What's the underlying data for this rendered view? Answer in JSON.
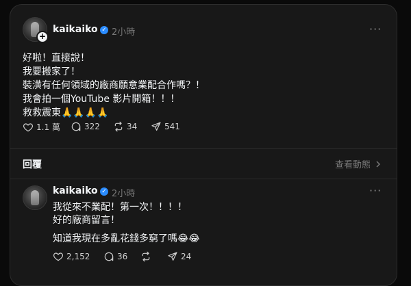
{
  "main_post": {
    "username": "kaikaiko",
    "time": "2小時",
    "more": "···",
    "lines": [
      "好啦！直接說！",
      "我要搬家了！",
      "裝潢有任何領域的廠商願意業配合作嗎？！",
      "我會拍一個YouTube 影片開箱！！！",
      "救救震東🙏🙏🙏🙏"
    ],
    "likes": "1.1 萬",
    "comments": "322",
    "reposts": "34",
    "shares": "541"
  },
  "replies_header": {
    "label": "回覆",
    "activity": "查看動態"
  },
  "reply": {
    "username": "kaikaiko",
    "time": "2小時",
    "more": "···",
    "lines": [
      "我從來不業配！第一次！！！！",
      "好的廠商留言！",
      "知道我現在多亂花錢多窮了嗎😂😂"
    ],
    "likes": "2,152",
    "comments": "36",
    "reposts": "",
    "shares": "24"
  },
  "icons": {
    "like": "heart-icon",
    "comment": "comment-bubble-icon",
    "repost": "repost-icon",
    "share": "share-paper-plane-icon",
    "verified": "verified-badge-icon",
    "chevron": "chevron-right-icon"
  },
  "colors": {
    "background": "#0a0a0a",
    "card": "#181818",
    "verified": "#2b8cff",
    "muted": "#777777"
  }
}
